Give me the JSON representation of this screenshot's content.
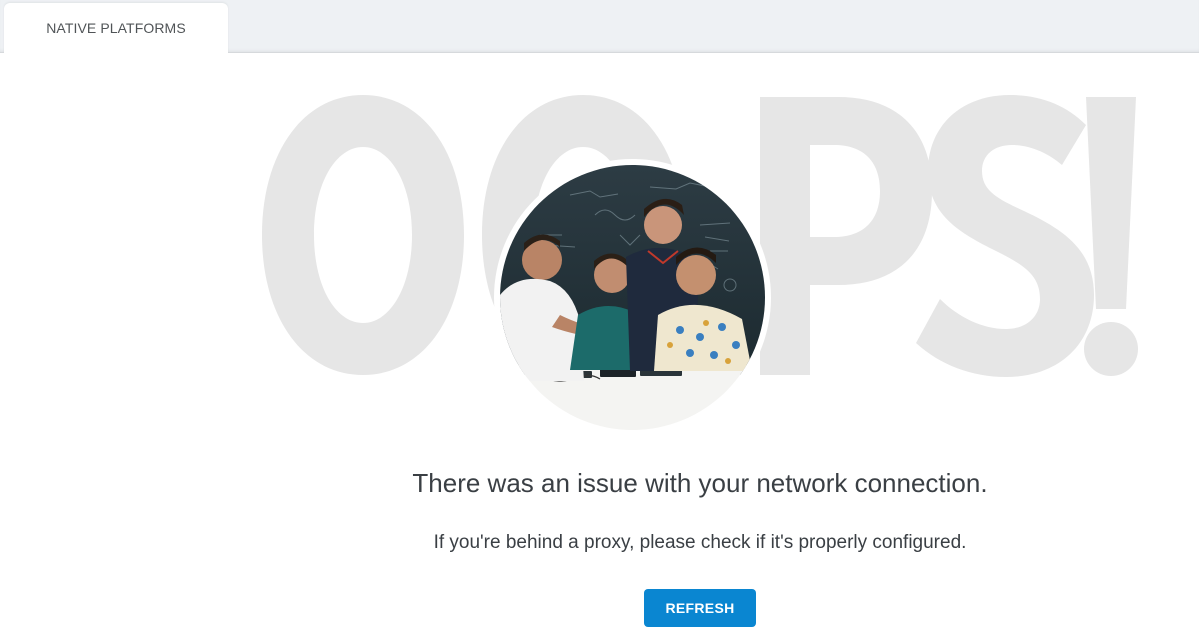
{
  "tabs": [
    {
      "label": "NATIVE PLATFORMS",
      "active": true
    }
  ],
  "error": {
    "watermark": "OOPS!",
    "headline": "There was an issue with your network connection.",
    "subline": "If you're behind a proxy, please check if it's properly configured.",
    "refresh_label": "REFRESH"
  },
  "colors": {
    "accent": "#0a86d1",
    "watermark": "#e6e6e6",
    "text": "#3a3f44"
  }
}
